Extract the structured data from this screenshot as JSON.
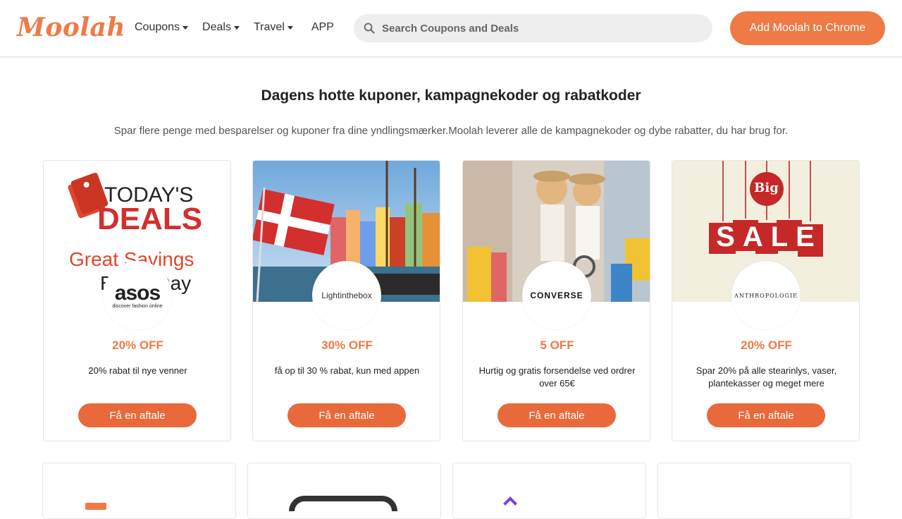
{
  "header": {
    "logo": "Moolah",
    "nav": [
      {
        "label": "Coupons",
        "dropdown": true
      },
      {
        "label": "Deals",
        "dropdown": true
      },
      {
        "label": "Travel",
        "dropdown": true
      },
      {
        "label": "APP",
        "dropdown": false
      }
    ],
    "search_placeholder": "Search Coupons and Deals",
    "cta": "Add Moolah to Chrome"
  },
  "main": {
    "title": "Dagens hotte kuponer, kampagnekoder og rabatkoder",
    "subtitle": "Spar flere penge med besparelser og kuponer fra dine yndlingsmærker.Moolah leverer alle de kampagnekoder og dybe rabatter, du har brug for."
  },
  "cards": [
    {
      "brand": "asos",
      "brand_tagline": "discover fashion online",
      "banner_text_1": "TODAY'S",
      "banner_text_2": "DEALS",
      "banner_text_3": "Great Savings",
      "banner_text_4": "Every Day",
      "discount": "20% OFF",
      "description": "20% rabat til nye venner",
      "button": "Få en aftale"
    },
    {
      "brand": "Lightinthebox",
      "discount": "30% OFF",
      "description": "få op til 30 % rabat, kun med appen",
      "button": "Få en aftale"
    },
    {
      "brand": "CONVERSE",
      "discount": "5 OFF",
      "description": "Hurtig og gratis forsendelse ved ordrer over 65€",
      "button": "Få en aftale"
    },
    {
      "brand": "ANTHROPOLOGIE",
      "banner_text_1": "Big",
      "banner_text_2": "SALE",
      "discount": "20% OFF",
      "description": "Spar 20% på alle stearinlys, vaser, plantekasser og meget mere",
      "button": "Få en aftale"
    }
  ],
  "colors": {
    "accent": "#ef7a45",
    "button": "#e9693b"
  }
}
